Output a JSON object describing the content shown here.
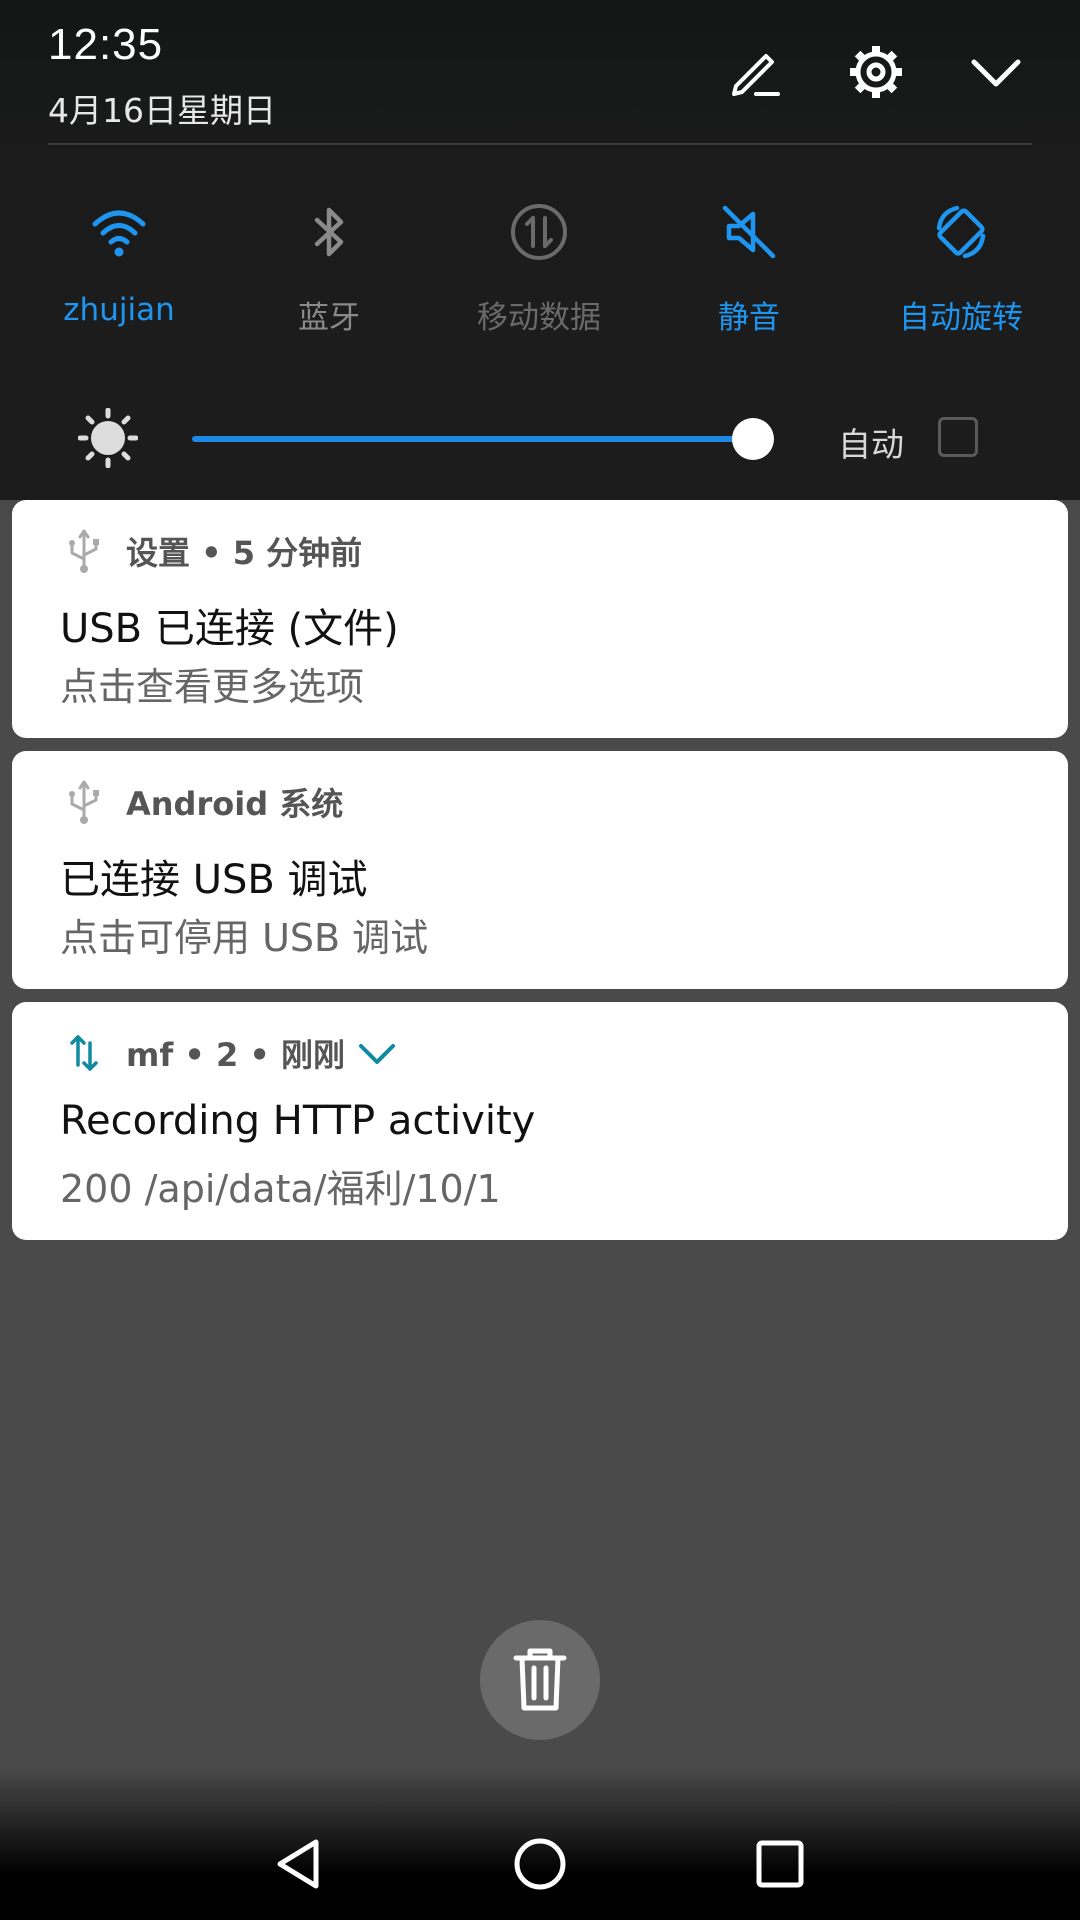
{
  "status": {
    "time": "12:35",
    "date": "4月16日星期日"
  },
  "header_icons": [
    "edit-icon",
    "settings-gear-icon",
    "collapse-chevron-icon"
  ],
  "quick_tiles": [
    {
      "label": "zhujian",
      "icon": "wifi-icon",
      "state": "on"
    },
    {
      "label": "蓝牙",
      "icon": "bluetooth-icon",
      "state": "off"
    },
    {
      "label": "移动数据",
      "icon": "mobile-data-icon",
      "state": "disabled"
    },
    {
      "label": "静音",
      "icon": "mute-icon",
      "state": "on"
    },
    {
      "label": "自动旋转",
      "icon": "auto-rotate-icon",
      "state": "on"
    }
  ],
  "brightness": {
    "level": 1.0,
    "auto_label": "自动",
    "auto_checked": false
  },
  "notifications": [
    {
      "icon": "usb-icon",
      "header": "设置 • 5 分钟前",
      "title": "USB 已连接 (文件)",
      "text": "点击查看更多选项"
    },
    {
      "icon": "usb-icon",
      "header": "Android 系统",
      "title": "已连接 USB 调试",
      "text": "点击可停用 USB 调试"
    },
    {
      "icon": "data-transfer-icon",
      "header": "mf • 2 • 刚刚",
      "title": "Recording HTTP activity",
      "text": "200 /api/data/福利/10/1",
      "expandable": true
    }
  ],
  "colors": {
    "accent": "#1e96f0",
    "shade_bg": "#1c1c1c",
    "screen_bg": "#4a4a4a",
    "card_bg": "#ffffff",
    "mf_icon": "#0f8aa0"
  },
  "clear_all_icon": "trash-icon",
  "navbar": [
    "back-icon",
    "home-icon",
    "recents-icon"
  ]
}
